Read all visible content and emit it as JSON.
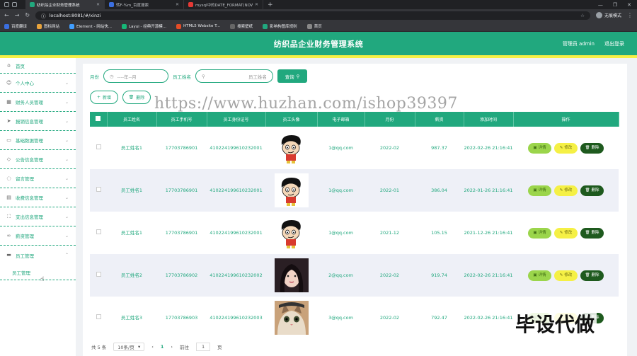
{
  "browser": {
    "tabs": [
      {
        "title": "纺织品企业财务管理系统",
        "active": true,
        "color": "#21a87e"
      },
      {
        "title": "转F-%m_百度搜索",
        "active": false,
        "color": "#3b6fe0"
      },
      {
        "title": "mysql中的DATE_FORMAT(NOW...",
        "active": false,
        "color": "#e53935"
      }
    ],
    "url": "localhost:8081/#/xinzi",
    "profile": "无痕模式",
    "bookmarks": [
      {
        "label": "百度翻译",
        "color": "#3b6fe0"
      },
      {
        "label": "图标网站",
        "color": "#e8a33b"
      },
      {
        "label": "Element - 网站快...",
        "color": "#409eff"
      },
      {
        "label": "Layui - 经典开源模...",
        "color": "#16b777"
      },
      {
        "label": "HTML5 Website T...",
        "color": "#e34c26"
      },
      {
        "label": "搜索壁纸",
        "color": "#666"
      },
      {
        "label": "影响构图库规则",
        "color": "#21a87e"
      },
      {
        "label": "首页",
        "color": "#888"
      }
    ]
  },
  "header": {
    "title": "纺织品企业财务管理系统",
    "user": "管理员 admin",
    "logout": "退出登录"
  },
  "sidebar": {
    "items": [
      {
        "label": "首页",
        "icon": "home-icon",
        "glyph": "⌂"
      },
      {
        "label": "个人中心",
        "icon": "user-icon",
        "glyph": "☺"
      },
      {
        "label": "财务人员管理",
        "icon": "grid-icon",
        "glyph": "▦"
      },
      {
        "label": "报销信息管理",
        "icon": "send-icon",
        "glyph": "➤"
      },
      {
        "label": "基础数据管理",
        "icon": "folder-icon",
        "glyph": "▭"
      },
      {
        "label": "公告信息管理",
        "icon": "tag-icon",
        "glyph": "◇"
      },
      {
        "label": "留言管理",
        "icon": "pin-icon",
        "glyph": "◌"
      },
      {
        "label": "收费信息管理",
        "icon": "card-icon",
        "glyph": "▤"
      },
      {
        "label": "支出信息管理",
        "icon": "expand-icon",
        "glyph": "⛶"
      },
      {
        "label": "薪资管理",
        "icon": "link-icon",
        "glyph": "∞"
      },
      {
        "label": "员工管理",
        "icon": "monitor-icon",
        "glyph": "▬"
      }
    ],
    "sub_item": "员工管理"
  },
  "search": {
    "month_label": "月份",
    "month_placeholder": "----年--月",
    "name_label": "员工姓名",
    "name_placeholder": "员工姓名",
    "search_button": "查询"
  },
  "actions": {
    "add": "新增",
    "delete": "删除"
  },
  "table": {
    "headers": [
      "员工姓名",
      "员工手机号",
      "员工身份证号",
      "员工头像",
      "电子邮箱",
      "月份",
      "薪资",
      "添加时间",
      "操作"
    ],
    "rows": [
      {
        "name": "员工姓名1",
        "phone": "17703786901",
        "idcard": "410224199610232001",
        "avatar": "cartoon",
        "email": "1@qq.com",
        "month": "2022-02",
        "salary": "987.37",
        "time": "2022-02-26 21:16:41"
      },
      {
        "name": "员工姓名1",
        "phone": "17703786901",
        "idcard": "410224199610232001",
        "avatar": "cartoon",
        "email": "1@qq.com",
        "month": "2022-01",
        "salary": "386.04",
        "time": "2022-01-26 21:16:41"
      },
      {
        "name": "员工姓名1",
        "phone": "17703786901",
        "idcard": "410224199610232001",
        "avatar": "cartoon",
        "email": "1@qq.com",
        "month": "2021-12",
        "salary": "105.15",
        "time": "2021-12-26 21:16:41"
      },
      {
        "name": "员工姓名2",
        "phone": "17703786902",
        "idcard": "410224199610232002",
        "avatar": "photo-girl",
        "email": "2@qq.com",
        "month": "2022-02",
        "salary": "919.74",
        "time": "2022-02-26 21:16:41"
      },
      {
        "name": "员工姓名3",
        "phone": "17703786903",
        "idcard": "410224199610232003",
        "avatar": "photo-cat",
        "email": "3@qq.com",
        "month": "2022-02",
        "salary": "792.47",
        "time": "2022-02-26 21:16:41"
      }
    ],
    "ops": {
      "detail": "详情",
      "edit": "修改",
      "delete": "删除"
    }
  },
  "pager": {
    "total": "共 5 条",
    "page_size": "10条/页",
    "current": "1",
    "goto_label": "前往",
    "goto_value": "1",
    "goto_unit": "页"
  },
  "watermark": "https://www.huzhan.com/ishop39397",
  "promo": "毕设代做",
  "colors": {
    "primary": "#21a87e",
    "accent": "#f5f045",
    "danger": "#1e5a1e",
    "detail": "#9bd54b"
  }
}
